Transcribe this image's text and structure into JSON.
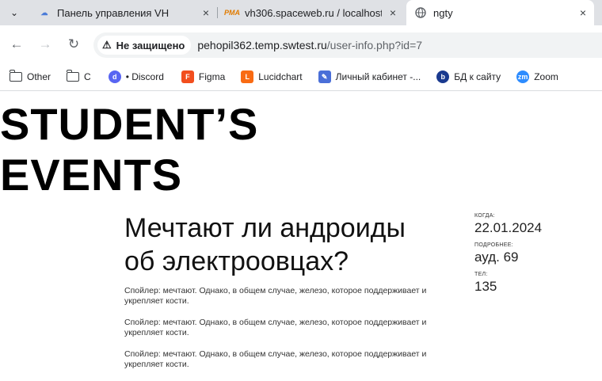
{
  "browser": {
    "tabs": [
      {
        "title": "Панель управления VH",
        "favicon": "vh-cloud-icon",
        "active": false
      },
      {
        "title": "vh306.spaceweb.ru / localhost /",
        "favicon": "phpmyadmin-icon",
        "active": false
      },
      {
        "title": "ngty",
        "favicon": "globe-icon",
        "active": true
      }
    ],
    "address": {
      "security_label": "Не защищено",
      "host": "pehopil362.temp.swtest.ru",
      "path": "/user-info.php?id=7"
    },
    "bookmarks": [
      {
        "label": "Other",
        "icon": "folder-icon"
      },
      {
        "label": "С",
        "icon": "folder-icon"
      },
      {
        "label": "• Discord",
        "icon": "discord-icon"
      },
      {
        "label": "Figma",
        "icon": "figma-icon"
      },
      {
        "label": "Lucidchart",
        "icon": "lucidchart-icon"
      },
      {
        "label": "Личный кабинет -...",
        "icon": "cabinet-icon"
      },
      {
        "label": "БД к сайту",
        "icon": "db-icon"
      },
      {
        "label": "Zoom",
        "icon": "zoom-icon"
      }
    ]
  },
  "site": {
    "logo_line1": "STUDENT’S",
    "logo_line2": "EVENTS"
  },
  "article": {
    "title_line1": "Мечтают ли андроиды",
    "title_line2": "об электроовцах?",
    "paragraphs": [
      "Спойлер: мечтают. Однако, в общем случае, железо, которое поддерживает и укрепляет кости.",
      "Спойлер: мечтают. Однако, в общем случае, железо, которое поддерживает и укрепляет кости.",
      "Спойлер: мечтают. Однако, в общем случае, железо, которое поддерживает и укрепляет кости."
    ]
  },
  "meta": {
    "when_label": "КОГДА:",
    "when_value": "22.01.2024",
    "details_label": "ПОДРОБНЕЕ:",
    "details_value": "ауд. 69",
    "phone_label": "ТЕЛ:",
    "phone_value": "135"
  },
  "colors": {
    "tabstrip": "#dfe1e5",
    "text": "#111111"
  }
}
